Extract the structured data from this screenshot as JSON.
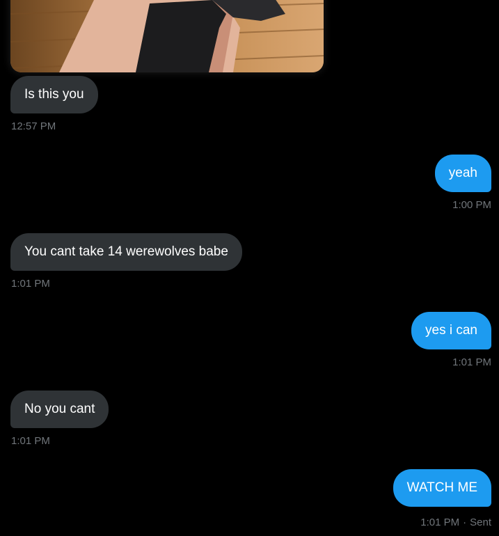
{
  "conversation": {
    "messages": [
      {
        "direction": "in",
        "text": "Is this you",
        "time": "12:57 PM"
      },
      {
        "direction": "out",
        "text": "yeah",
        "time": "1:00 PM"
      },
      {
        "direction": "in",
        "text": "You cant take 14 werewolves babe",
        "time": "1:01 PM"
      },
      {
        "direction": "out",
        "text": "yes i can",
        "time": "1:01 PM"
      },
      {
        "direction": "in",
        "text": "No you cant",
        "time": "1:01 PM"
      },
      {
        "direction": "out",
        "text": "WATCH ME",
        "time": "1:01 PM",
        "status": "Sent"
      }
    ]
  },
  "colors": {
    "background": "#000000",
    "incoming_bubble": "#2f3336",
    "outgoing_bubble": "#1d9bf0",
    "timestamp": "#71767b"
  }
}
